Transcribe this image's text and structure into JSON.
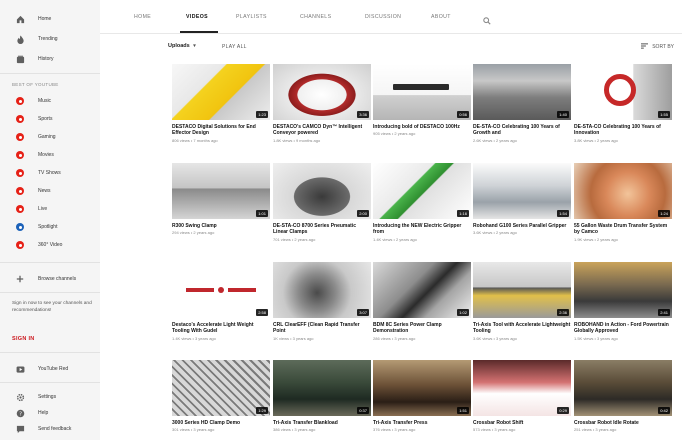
{
  "sidebar": {
    "nav": [
      {
        "label": "Home",
        "icon": "home-icon"
      },
      {
        "label": "Trending",
        "icon": "trending-icon"
      },
      {
        "label": "History",
        "icon": "history-icon"
      }
    ],
    "best_heading": "BEST OF YOUTUBE",
    "best": [
      {
        "label": "Music",
        "color": "#e62117"
      },
      {
        "label": "Sports",
        "color": "#e62117"
      },
      {
        "label": "Gaming",
        "color": "#e62117"
      },
      {
        "label": "Movies",
        "color": "#e62117"
      },
      {
        "label": "TV Shows",
        "color": "#e62117"
      },
      {
        "label": "News",
        "color": "#e62117"
      },
      {
        "label": "Live",
        "color": "#e62117"
      },
      {
        "label": "Spotlight",
        "color": "#1c62b9"
      },
      {
        "label": "360° Video",
        "color": "#e62117"
      }
    ],
    "browse": "Browse channels",
    "signin_text": "Sign in now to see your channels and recommendations!",
    "signin_button": "SIGN IN",
    "bottom": [
      {
        "label": "YouTube Red",
        "icon": "youtube-red-icon"
      },
      {
        "label": "Settings",
        "icon": "gear-icon"
      },
      {
        "label": "Help",
        "icon": "help-icon"
      },
      {
        "label": "Send feedback",
        "icon": "feedback-icon"
      }
    ]
  },
  "tabs": [
    {
      "label": "HOME",
      "active": false
    },
    {
      "label": "VIDEOS",
      "active": true
    },
    {
      "label": "PLAYLISTS",
      "active": false
    },
    {
      "label": "CHANNELS",
      "active": false
    },
    {
      "label": "DISCUSSION",
      "active": false
    },
    {
      "label": "ABOUT",
      "active": false
    }
  ],
  "uploads": {
    "label": "Uploads",
    "play_all": "PLAY ALL",
    "sort_by": "SORT BY"
  },
  "videos": [
    {
      "title": "DESTACO Digital Solutions for End Effector Design",
      "meta": "806 views • 7 months ago",
      "duration": "1:23",
      "theme": "yellow"
    },
    {
      "title": "DESTACO's CAMCO Dyn™ Intelligent Conveyor powered",
      "meta": "1.8K views • 9 months ago",
      "duration": "3:36",
      "theme": "red"
    },
    {
      "title": "Introducing bold of DESTACO 100Hz",
      "meta": "905 views • 2 years ago",
      "duration": "0:56",
      "theme": "logo"
    },
    {
      "title": "DE-STA-CO Celebrating 100 Years of Growth and",
      "meta": "2.6K views • 2 years ago",
      "duration": "1:40",
      "theme": "industrial"
    },
    {
      "title": "DE-STA-CO Celebrating 100 Years of Innovation",
      "meta": "3.8K views • 2 years ago",
      "duration": "1:55",
      "theme": "hundred"
    },
    {
      "title": "R300 Swing Clamp",
      "meta": "294 views • 2 years ago",
      "duration": "1:01",
      "theme": "gray"
    },
    {
      "title": "DE-STA-CO 8700 Series Pneumatic Linear Clamps",
      "meta": "701 views • 2 years ago",
      "duration": "2:00",
      "theme": "dark"
    },
    {
      "title": "Introducing the NEW Electric Gripper from",
      "meta": "1.4K views • 2 years ago",
      "duration": "1:16",
      "theme": "bright"
    },
    {
      "title": "Robohand G100 Series Parallel Gripper",
      "meta": "3.6K views • 2 years ago",
      "duration": "1:54",
      "theme": "steel"
    },
    {
      "title": "55 Gallon Waste Drum Transfer System by Camco",
      "meta": "1.9K views • 2 years ago",
      "duration": "1:24",
      "theme": "copper"
    },
    {
      "title": "Destaco's Accelerate Light Weight Tooling With Gudel",
      "meta": "1.4K views • 3 years ago",
      "duration": "2:58",
      "theme": "gudel"
    },
    {
      "title": "CRL ClearEFF (Clean Rapid Transfer Point",
      "meta": "1K views • 3 years ago",
      "duration": "3:07",
      "theme": "pipe"
    },
    {
      "title": "BDM 8C Series Power Clamp Demonstration",
      "meta": "286 views • 3 years ago",
      "duration": "1:02",
      "theme": "clamp"
    },
    {
      "title": "Tri-Axis Tool with Accelerate Lightweight Tooling",
      "meta": "3.6K views • 3 years ago",
      "duration": "2:36",
      "theme": "robot"
    },
    {
      "title": "ROBOHAND in Action - Ford Powertrain Globally Approved",
      "meta": "1.5K views • 3 years ago",
      "duration": "2:41",
      "theme": "factory"
    },
    {
      "title": "3000 Series HD Clamp Demo",
      "meta": "301 views • 3 years ago",
      "duration": "1:29",
      "theme": "grid"
    },
    {
      "title": "Tri-Axis Transfer Blankload",
      "meta": "386 views • 3 years ago",
      "duration": "0:37",
      "theme": "press"
    },
    {
      "title": "Tri-Axis Transfer Press",
      "meta": "376 views • 3 years ago",
      "duration": "1:51",
      "theme": "press2"
    },
    {
      "title": "Crossbar Robot Shift",
      "meta": "573 views • 3 years ago",
      "duration": "0:29",
      "theme": "floor"
    },
    {
      "title": "Crossbar Robot Idle Rotate",
      "meta": "251 views • 3 years ago",
      "duration": "0:42",
      "theme": "hall"
    }
  ]
}
